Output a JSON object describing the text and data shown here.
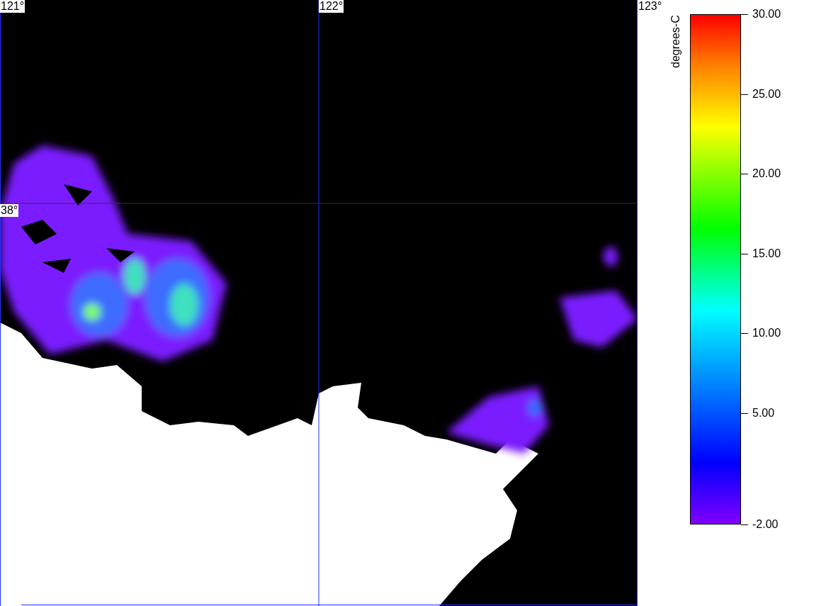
{
  "map": {
    "lon_labels": [
      "121°",
      "122°",
      "123°"
    ],
    "lat_labels": [
      "38°"
    ]
  },
  "colorbar": {
    "title": "degrees-C",
    "ticks": [
      "30.00",
      "25.00",
      "20.00",
      "15.00",
      "10.00",
      "5.00",
      "-2.00"
    ]
  }
}
